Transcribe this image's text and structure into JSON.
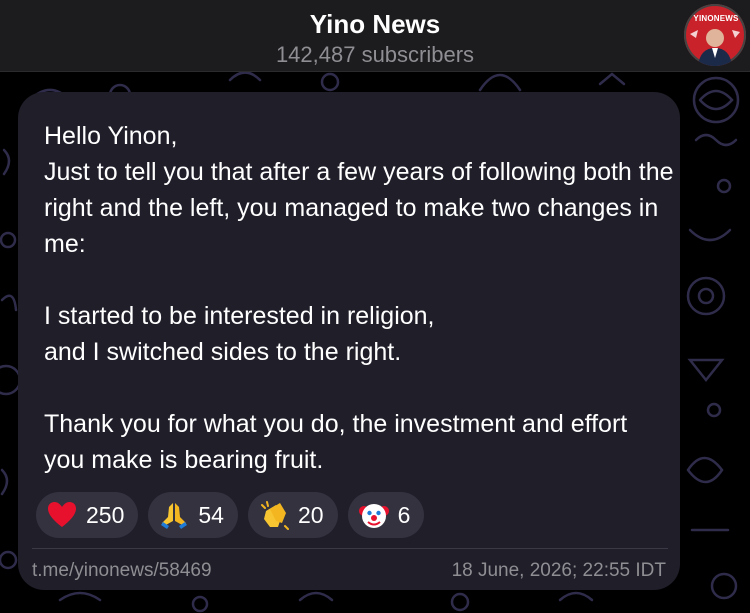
{
  "header": {
    "title": "Yino News",
    "subtitle": "142,487 subscribers",
    "avatar_badge": "YINONEWS",
    "avatar_color": "#c9222a"
  },
  "message": {
    "lines": [
      "Hello Yinon,",
      "Just to tell you that after a few years of following both the right and the left, you managed to make two changes in me:",
      "",
      "I started to be interested in religion,",
      "and I switched sides to the right.",
      "",
      "Thank you for what you do, the investment and effort you make is bearing fruit."
    ]
  },
  "reactions": [
    {
      "icon": "heart-emoji",
      "count": "250"
    },
    {
      "icon": "praying-hands-emoji",
      "count": "54"
    },
    {
      "icon": "clapping-hands-emoji",
      "count": "20"
    },
    {
      "icon": "clown-face-emoji",
      "count": "6"
    }
  ],
  "footer": {
    "link": "t.me/yinonews/58469",
    "timestamp": "18 June, 2026; 22:55 IDT"
  },
  "colors": {
    "background": "#000000",
    "header": "#1c1c1e",
    "bubble": "#1f1e29",
    "reaction_pill": "#33323e",
    "pattern": "#2e2c4a",
    "secondary_text": "#8e8e93"
  }
}
